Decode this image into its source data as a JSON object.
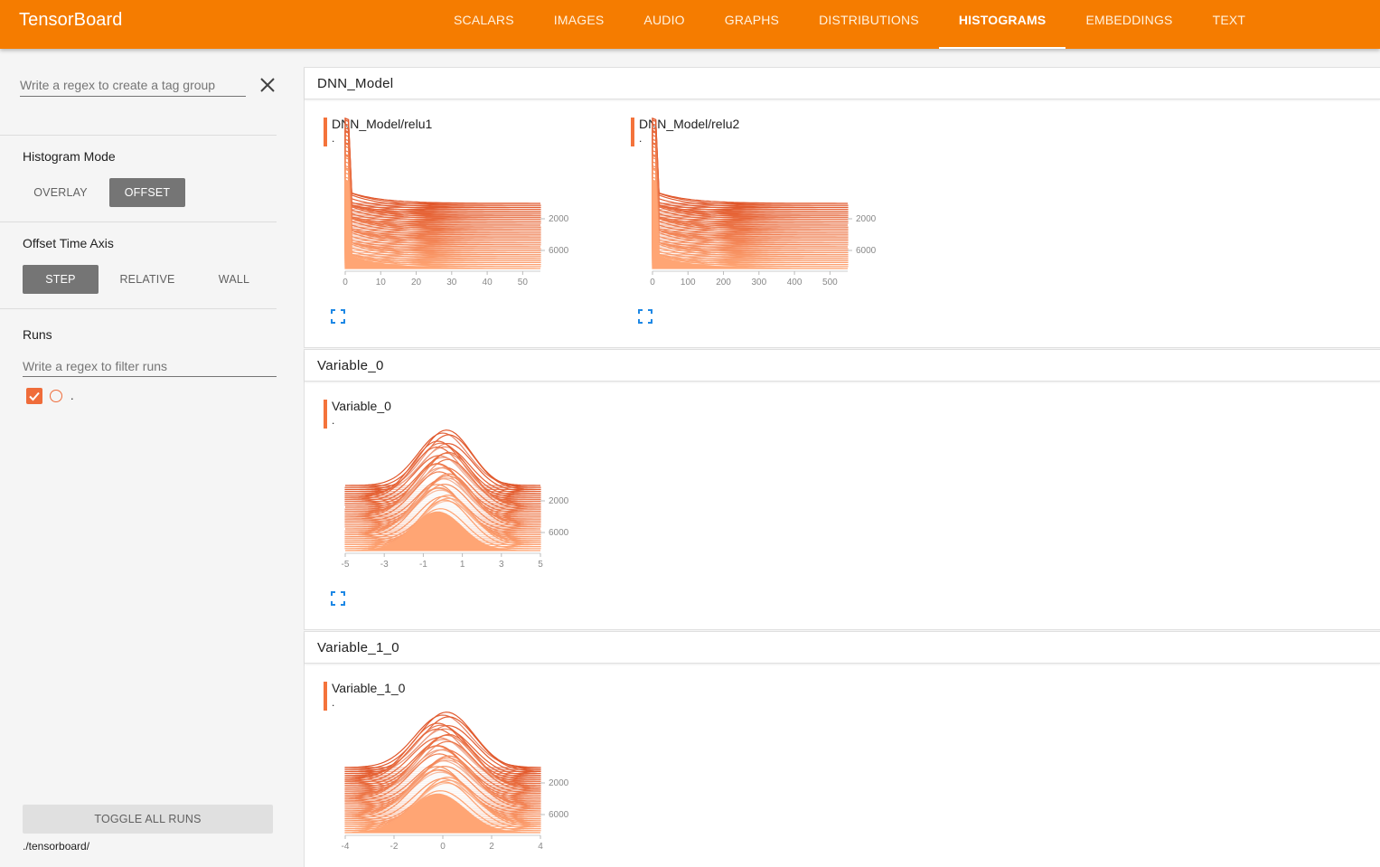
{
  "app": {
    "title": "TensorBoard"
  },
  "tabs": [
    {
      "label": "SCALARS"
    },
    {
      "label": "IMAGES"
    },
    {
      "label": "AUDIO"
    },
    {
      "label": "GRAPHS"
    },
    {
      "label": "DISTRIBUTIONS"
    },
    {
      "label": "HISTOGRAMS",
      "active": true
    },
    {
      "label": "EMBEDDINGS"
    },
    {
      "label": "TEXT"
    }
  ],
  "sidebar": {
    "tag_regex_placeholder": "Write a regex to create a tag group",
    "histogram_mode": {
      "label": "Histogram Mode",
      "options": [
        "OVERLAY",
        "OFFSET"
      ],
      "selected": "OFFSET"
    },
    "offset_time_axis": {
      "label": "Offset Time Axis",
      "options": [
        "STEP",
        "RELATIVE",
        "WALL"
      ],
      "selected": "STEP"
    },
    "runs": {
      "label": "Runs",
      "filter_placeholder": "Write a regex to filter runs",
      "items": [
        {
          "name": ".",
          "checked": true
        }
      ]
    },
    "toggle_all_label": "TOGGLE ALL RUNS",
    "logdir": "./tensorboard/"
  },
  "colors": {
    "accent": "#f57c00",
    "run": "#f4733b",
    "histogram_dark": "#e0562a",
    "histogram_light": "#ffa574"
  },
  "icons": {
    "close": "close-icon",
    "expand": "fullscreen-icon"
  },
  "groups": [
    {
      "name": "DNN_Model",
      "cards": [
        {
          "tag": "DNN_Model/relu1",
          "run": ".",
          "chart_data": {
            "type": "histogram-offset",
            "shape": "relu",
            "x_ticks": [
              "0",
              "10",
              "20",
              "30",
              "40",
              "50"
            ],
            "y_ticks": [
              "2000",
              "6000"
            ],
            "xlim": [
              0,
              55
            ]
          }
        },
        {
          "tag": "DNN_Model/relu2",
          "run": ".",
          "chart_data": {
            "type": "histogram-offset",
            "shape": "relu",
            "x_ticks": [
              "0",
              "100",
              "200",
              "300",
              "400",
              "500"
            ],
            "y_ticks": [
              "2000",
              "6000"
            ],
            "xlim": [
              0,
              550
            ]
          }
        }
      ]
    },
    {
      "name": "Variable_0",
      "cards": [
        {
          "tag": "Variable_0",
          "run": ".",
          "chart_data": {
            "type": "histogram-offset",
            "shape": "gaussian",
            "x_ticks": [
              "-5",
              "-3",
              "-1",
              "1",
              "3",
              "5"
            ],
            "y_ticks": [
              "2000",
              "6000"
            ],
            "xlim": [
              -5,
              5
            ]
          }
        }
      ]
    },
    {
      "name": "Variable_1_0",
      "cards": [
        {
          "tag": "Variable_1_0",
          "run": ".",
          "chart_data": {
            "type": "histogram-offset",
            "shape": "gaussian",
            "x_ticks": [
              "-4",
              "-2",
              "0",
              "2",
              "4"
            ],
            "y_ticks": [
              "2000",
              "6000"
            ],
            "xlim": [
              -4,
              4
            ]
          }
        }
      ]
    }
  ]
}
